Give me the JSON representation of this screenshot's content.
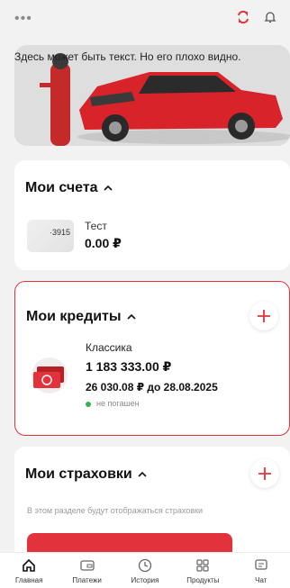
{
  "header": {
    "menu_icon": "more-dots-icon",
    "sync_icon": "sync-icon",
    "bell_icon": "bell-icon"
  },
  "banner": {
    "text": "Здесь может быть текст. Но его плохо видно."
  },
  "accounts": {
    "title": "Мои счета",
    "items": [
      {
        "card_suffix": "·3915",
        "name": "Тест",
        "balance": "0.00 ₽"
      }
    ]
  },
  "credits": {
    "title": "Мои кредиты",
    "items": [
      {
        "name": "Классика",
        "amount": "1 183 333.00 ₽",
        "payment": "26 030.08 ₽ до 28.08.2025",
        "status": "не погашен",
        "status_color": "#37b24d"
      }
    ]
  },
  "insurance": {
    "title": "Мои страховки",
    "note": "В этом разделе будут отображаться страховки"
  },
  "nav": {
    "items": [
      {
        "label": "Главная",
        "icon": "home-icon"
      },
      {
        "label": "Платежи",
        "icon": "card-icon"
      },
      {
        "label": "История",
        "icon": "clock-icon"
      },
      {
        "label": "Продукты",
        "icon": "grid-icon"
      },
      {
        "label": "Чат",
        "icon": "chat-icon"
      }
    ]
  },
  "colors": {
    "accent": "#e2333c",
    "background": "#f3f2f2"
  }
}
